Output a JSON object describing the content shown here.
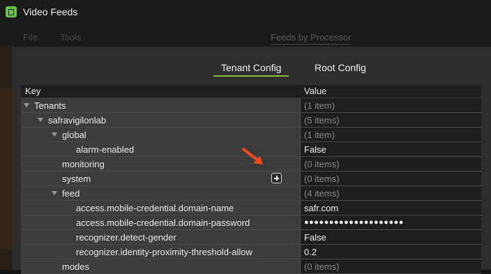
{
  "window": {
    "title": "Video Feeds"
  },
  "menubar": {
    "items": [
      "File",
      "Tools"
    ],
    "background_tab": "Feeds by Processor"
  },
  "dialog": {
    "tabs": [
      {
        "label": "Tenant Config",
        "selected": true
      },
      {
        "label": "Root Config",
        "selected": false
      }
    ],
    "columns": {
      "key": "Key",
      "value": "Value"
    },
    "rows": [
      {
        "key": "Tenants",
        "value": "(1 item)"
      },
      {
        "key": "safravigilonlab",
        "value": "(5 items)"
      },
      {
        "key": "global",
        "value": "(1 item)"
      },
      {
        "key": "alarm-enabled",
        "value": "False"
      },
      {
        "key": "monitoring",
        "value": "(0 items)"
      },
      {
        "key": "system",
        "value": "(0 items)"
      },
      {
        "key": "feed",
        "value": "(4 items)"
      },
      {
        "key": "access.mobile-credential.domain-name",
        "value": "safr.com"
      },
      {
        "key": "access.mobile-credential.domain-password",
        "value": "●●●●●●●●●●●●●●●●●●●●"
      },
      {
        "key": "recognizer.detect-gender",
        "value": "False"
      },
      {
        "key": "recognizer.identity-proximity-threshold-allow",
        "value": "0.2"
      },
      {
        "key": "modes",
        "value": "(0 items)"
      }
    ]
  },
  "colors": {
    "accent": "#8fbf3a",
    "annotation_arrow": "#f04a1e",
    "app_icon": "#6cc04a"
  },
  "icons": {
    "app": "video-feeds-app-icon",
    "add": "plus-square-icon",
    "annotation": "red-arrow-icon"
  }
}
